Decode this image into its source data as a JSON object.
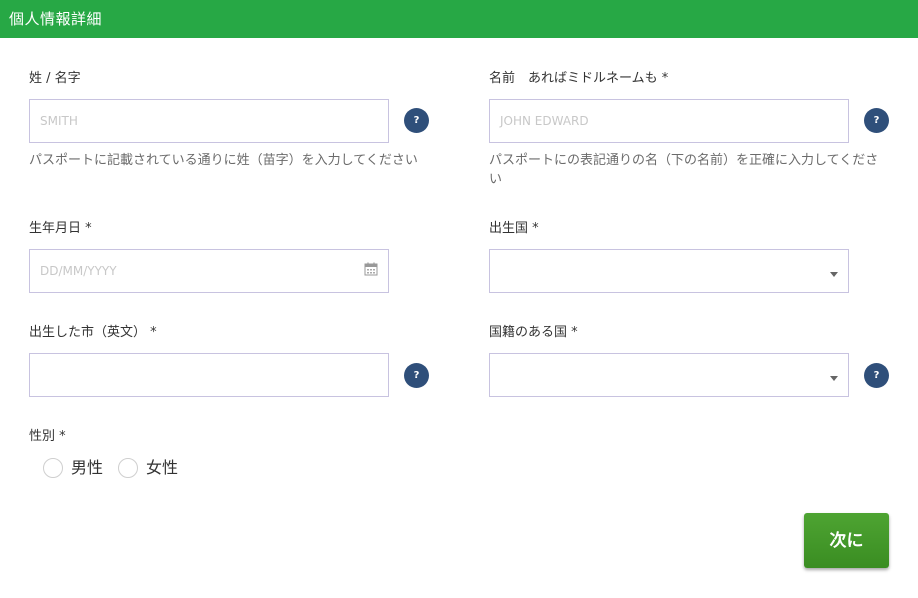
{
  "header": {
    "title": "個人情報詳細"
  },
  "form": {
    "surname": {
      "label": "姓 / 名字",
      "placeholder": "SMITH",
      "help": "?",
      "hint": "パスポートに記載されている通りに姓（苗字）を入力してください"
    },
    "given_names": {
      "label": "名前　あればミドルネームも *",
      "placeholder": "JOHN EDWARD",
      "help": "?",
      "hint": "パスポートにの表記通りの名（下の名前）を正確に入力してください"
    },
    "birth_date": {
      "label": "生年月日 *",
      "placeholder": "DD/MM/YYYY",
      "icon": "calendar-icon"
    },
    "birth_country": {
      "label": "出生国 *",
      "value": "",
      "icon": "caret-down-icon"
    },
    "birth_city": {
      "label": "出生した市（英文） *",
      "value": "",
      "help": "?"
    },
    "nationality": {
      "label": "国籍のある国 *",
      "value": "",
      "help": "?",
      "icon": "caret-down-icon"
    },
    "gender": {
      "label": "性別 *",
      "options": [
        "男性",
        "女性"
      ],
      "selected": null
    }
  },
  "actions": {
    "next_label": "次に"
  },
  "colors": {
    "header_bg": "#27a845",
    "help_bg": "#2f4f7a",
    "field_border": "#c8c3e0",
    "next_button": "#439b2a"
  }
}
